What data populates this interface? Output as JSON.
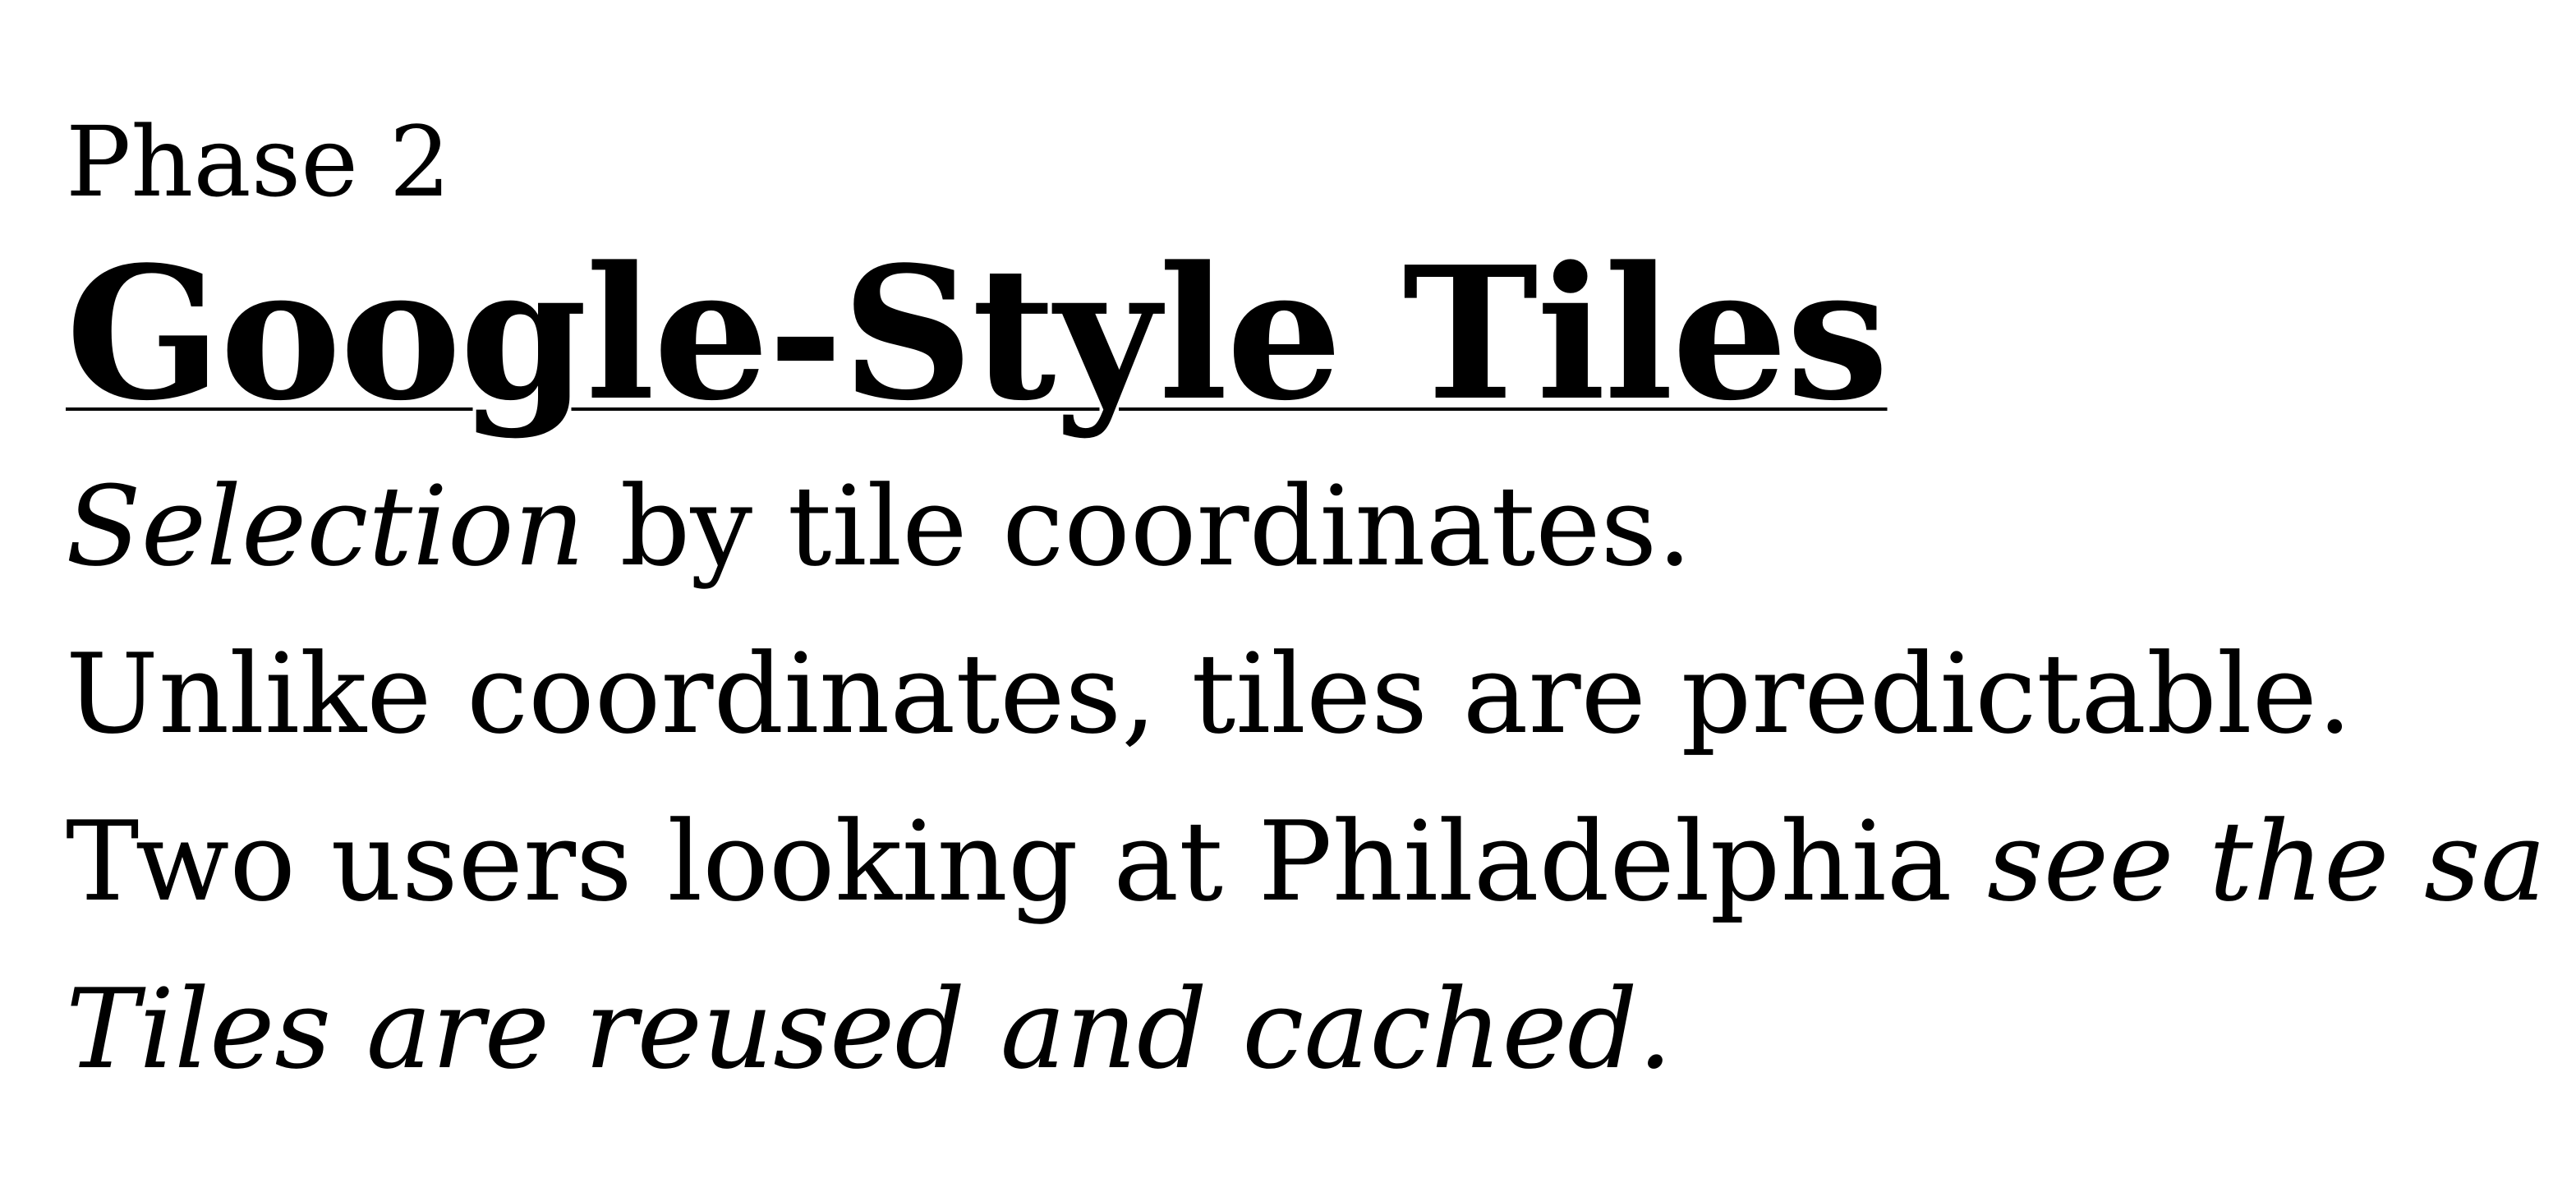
{
  "slide": {
    "eyebrow": "Phase 2",
    "title": "Google-Style Tiles",
    "lines": [
      {
        "italic": "Selection",
        "text": " by tile coordinates."
      },
      {
        "text": "Unlike coordinates, tiles are predictable."
      },
      {
        "text": "Two users looking at Philadelphia ",
        "italic": "see the sa"
      },
      {
        "italic": "Tiles are reused and cached."
      }
    ]
  },
  "colors": {
    "background": "#ffffff",
    "text": "#000000"
  }
}
